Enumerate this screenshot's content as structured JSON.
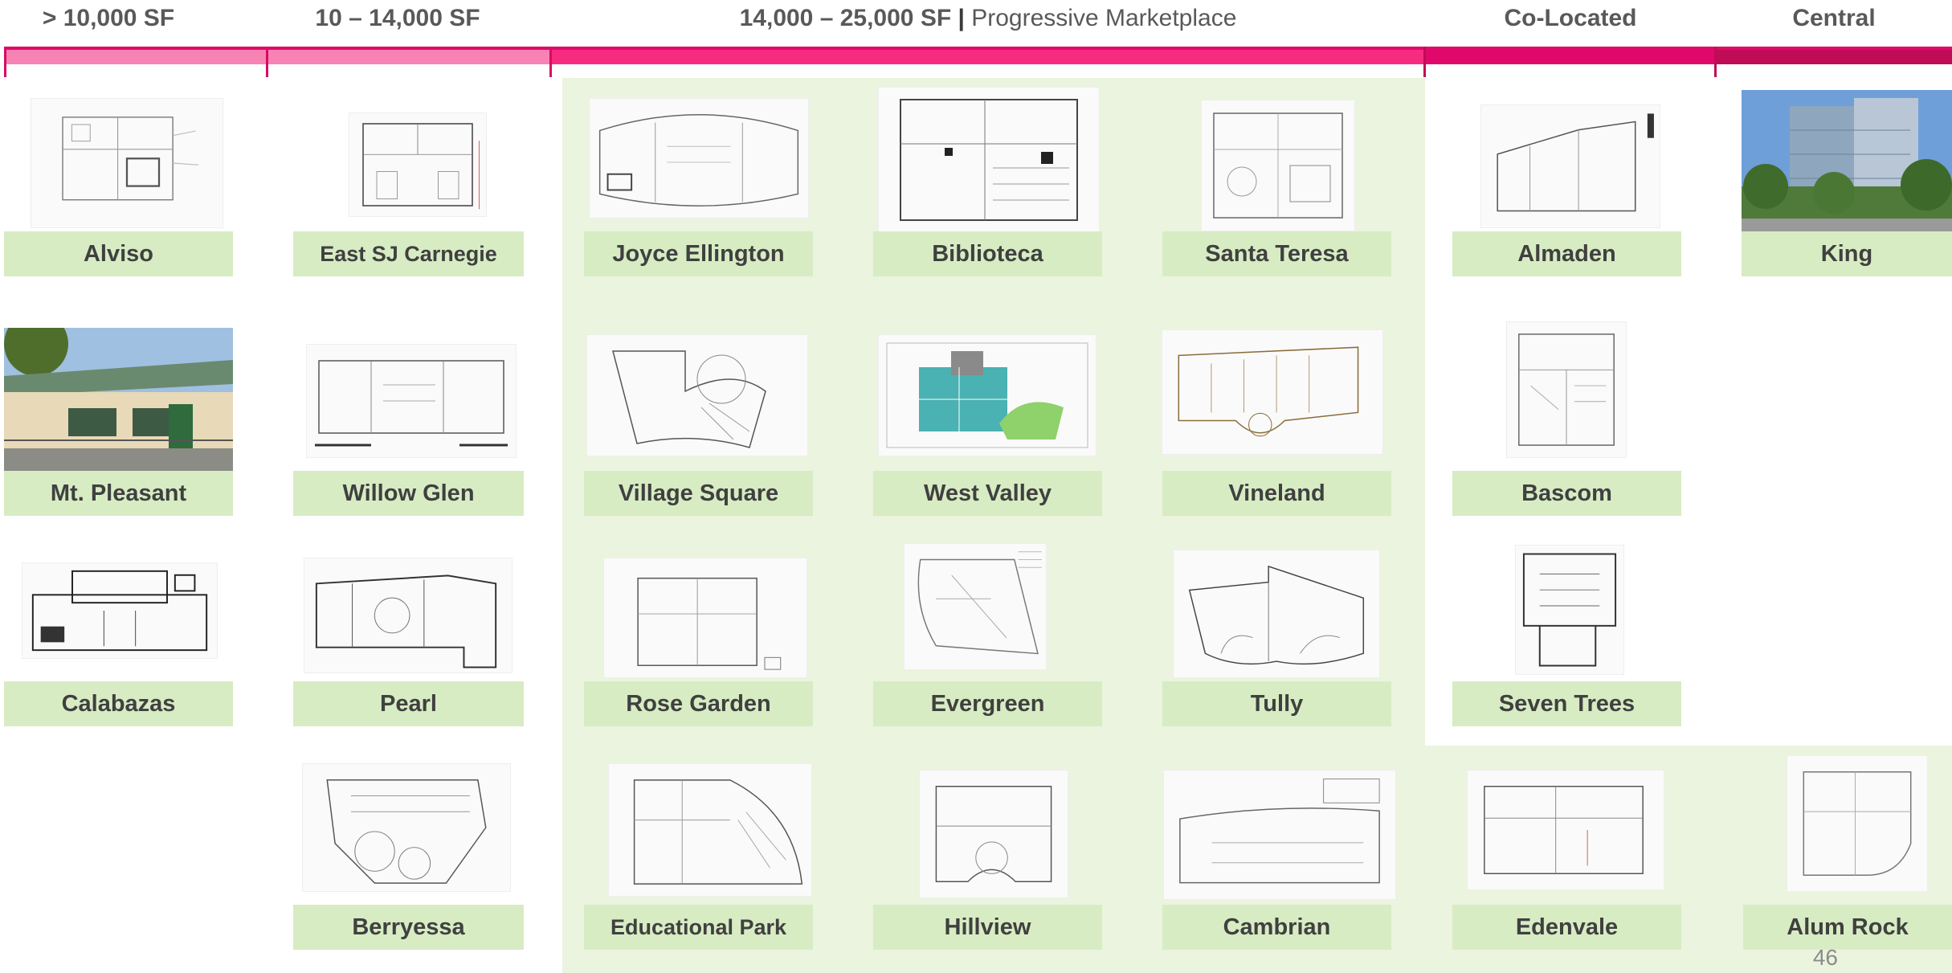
{
  "headers": {
    "under_10k": "> 10,000 SF",
    "mid": "10 – 14,000 SF",
    "range_main": "14,000 – 25,000 SF",
    "range_sep": "|",
    "range_sub": "Progressive Marketplace",
    "colocated": "Co-Located",
    "central": "Central"
  },
  "colors": {
    "bar_1": "#f783b4",
    "bar_2": "#f882b3",
    "bar_3": "#f72c80",
    "bar_4": "#e0086a",
    "bar_5": "#c00c56",
    "label_bg": "#d7ecc3",
    "region_bg": "#ebf4de"
  },
  "libraries": {
    "alviso": "Alviso",
    "east_sj_carnegie": "East SJ Carnegie",
    "joyce_ellington": "Joyce Ellington",
    "biblioteca": "Biblioteca",
    "santa_teresa": "Santa Teresa",
    "almaden": "Almaden",
    "king": "King",
    "mt_pleasant": "Mt. Pleasant",
    "willow_glen": "Willow Glen",
    "village_square": "Village Square",
    "west_valley": "West Valley",
    "vineland": "Vineland",
    "bascom": "Bascom",
    "calabazas": "Calabazas",
    "pearl": "Pearl",
    "rose_garden": "Rose Garden",
    "evergreen": "Evergreen",
    "tully": "Tully",
    "seven_trees": "Seven Trees",
    "berryessa": "Berryessa",
    "educational_park": "Educational Park",
    "hillview": "Hillview",
    "cambrian": "Cambrian",
    "edenvale": "Edenvale",
    "alum_rock": "Alum Rock"
  },
  "page_number": "46"
}
